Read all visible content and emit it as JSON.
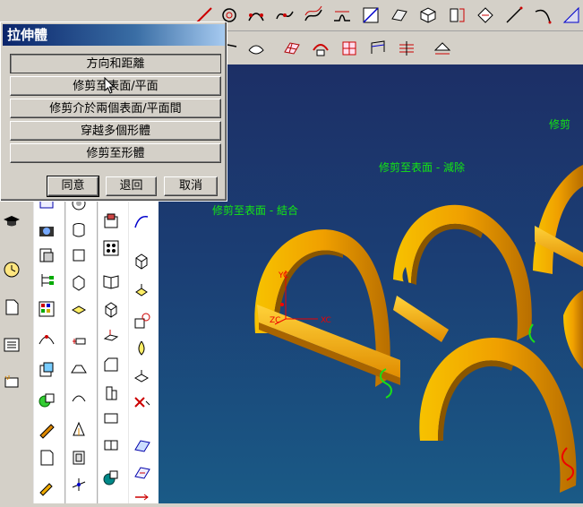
{
  "dialog": {
    "title": "拉伸體",
    "options": [
      "方向和距離",
      "修剪至表面/平面",
      "修剪介於兩個表面/平面間",
      "穿越多個形體",
      "修剪至形體"
    ],
    "buttons": {
      "ok": "同意",
      "back": "退回",
      "cancel": "取消"
    }
  },
  "viewport": {
    "annotations": {
      "trim_union": "修剪至表面 - 結合",
      "trim_subtract": "修剪至表面 - 減除",
      "trim_partial": "修剪"
    },
    "axes": {
      "x_label": "XC",
      "y_label": "YC",
      "z_label": "ZC"
    },
    "colors": {
      "part": "#f2a600",
      "background_top": "#1c2f66",
      "background_bottom": "#1a5a86",
      "annotation": "#14e614"
    }
  },
  "toolbar_icons": [
    "curve-icon",
    "sketch-icon",
    "point-set-icon",
    "spline-icon",
    "offset-curve-icon",
    "bridge-curve-icon",
    "surface-icon",
    "section-icon",
    "extrude-icon",
    "revolve-icon",
    "trim-icon",
    "line-icon",
    "arc-icon",
    "datum-icon"
  ]
}
